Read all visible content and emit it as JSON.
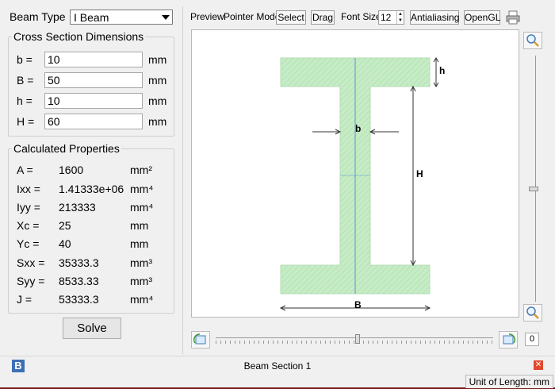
{
  "beam_type": {
    "label": "Beam Type",
    "value": "I Beam"
  },
  "cross_section": {
    "title": "Cross Section Dimensions",
    "fields": [
      {
        "label": "b =",
        "value": "10",
        "unit": "mm"
      },
      {
        "label": "B =",
        "value": "50",
        "unit": "mm"
      },
      {
        "label": "h =",
        "value": "10",
        "unit": "mm"
      },
      {
        "label": "H =",
        "value": "60",
        "unit": "mm"
      }
    ]
  },
  "properties": {
    "title": "Calculated Properties",
    "rows": [
      {
        "label": "A =",
        "value": "1600",
        "unit": "mm²"
      },
      {
        "label": "Ixx =",
        "value": "1.41333e+06",
        "unit": "mm⁴"
      },
      {
        "label": "Iyy =",
        "value": "213333",
        "unit": "mm⁴"
      },
      {
        "label": "Xc =",
        "value": "25",
        "unit": "mm"
      },
      {
        "label": "Yc =",
        "value": "40",
        "unit": "mm"
      },
      {
        "label": "Sxx =",
        "value": "35333.3",
        "unit": "mm³"
      },
      {
        "label": "Syy =",
        "value": "8533.33",
        "unit": "mm³"
      },
      {
        "label": "J =",
        "value": "53333.3",
        "unit": "mm⁴"
      }
    ]
  },
  "solve_label": "Solve",
  "toolbar": {
    "preview": "Preview",
    "pointer_mode": "Pointer Mode",
    "select": "Select",
    "drag": "Drag",
    "font_size_label": "Font Size",
    "font_size_value": "12",
    "antialiasing": "Antialiasing",
    "opengl": "OpenGL"
  },
  "drawing": {
    "label_b": "b",
    "label_B": "B",
    "label_h": "h",
    "label_H": "H",
    "fill_color": "#c6ecc6",
    "axis_color": "#5a8fd8"
  },
  "zoom_value": "0",
  "document_tab": "Beam Section 1",
  "doc_icon": "B",
  "unit_of_length": "Unit of Length: mm",
  "colors": {
    "close_red": "#e04a2f",
    "doc_icon_blue": "#3d6fb6"
  }
}
